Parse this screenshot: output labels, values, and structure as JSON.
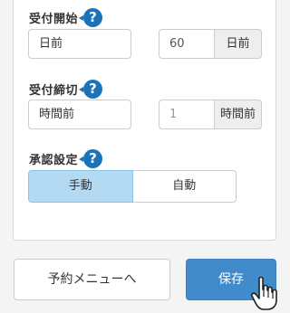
{
  "reception_start": {
    "label": "受付開始",
    "help_icon": "?",
    "day_select": "日前",
    "number_value": "60",
    "unit": "日前"
  },
  "reception_end": {
    "label": "受付締切",
    "help_icon": "?",
    "time_select": "時間前",
    "number_placeholder": "1",
    "unit": "時間前"
  },
  "approval": {
    "label": "承認設定",
    "help_icon": "?",
    "options": [
      "手動",
      "自動"
    ],
    "selected": "手動"
  },
  "buttons": {
    "back": "予約メニューへ",
    "save": "保存"
  },
  "colors": {
    "help": "#1a73b8",
    "primary": "#428bca",
    "toggle_active": "#b3daf2"
  },
  "icons": {
    "cursor": "hand-pointer-icon"
  }
}
